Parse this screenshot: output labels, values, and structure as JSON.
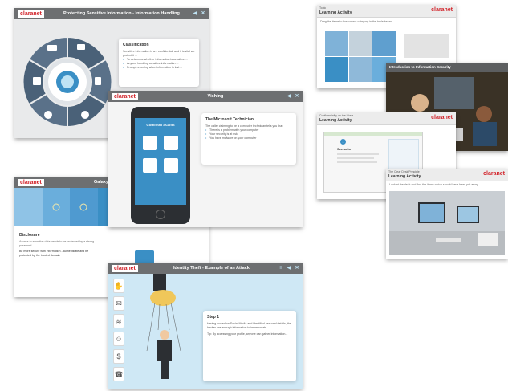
{
  "colors": {
    "brand_red": "#d2232a",
    "header_gray": "#6d6f71",
    "accent_blue": "#3a8fc5",
    "wheel_slate": "#4a6178"
  },
  "brand": "claranet",
  "panel_info_handling": {
    "title": "Protecting Sensitive Information - Information Handling",
    "box_heading": "Classification",
    "box_body": "Sensitive information is a... confidential, and it is vital we protect it ...",
    "bullets": [
      "To determine whether information is sensitive ...",
      "Anyone handling sensitive information ...",
      "Prompt reporting when information is lost ..."
    ],
    "wheel_icons": [
      "envelope-icon",
      "book-icon",
      "search-icon",
      "refresh-icon",
      "server-icon",
      "laptop-icon"
    ]
  },
  "panel_vishing": {
    "title": "Vishing",
    "phone_screen_title": "Common Scams",
    "box_heading": "The Microsoft Technician",
    "box_body": "The caller claiming to be a computer technician tells you that:",
    "bullets": [
      "There is a problem with your computer",
      "Your security is at risk",
      "You have malware on your computer"
    ]
  },
  "panel_safety_aware": {
    "title": "Galaxy Security Aware",
    "heading": "Disclosure",
    "body_1": "Access to sensitive data needs to be protected by a strong password...",
    "body_2": "Be more secure with information - authenticate and be protected by the trusted domain"
  },
  "panel_identity_theft": {
    "title": "Identity Theft - Example of an Attack",
    "step_heading": "Step 1",
    "step_body": "Having looked on Social Media and identified personal details, the hacker has enough information to impersonate...",
    "step_body_2": "Tip: By accessing your profile, anyone can gather information..."
  },
  "panel_learning_1": {
    "small": "Topic",
    "name": "Learning Activity",
    "intro": "Drag the items to the correct category in the table below."
  },
  "panel_info_security": {
    "title": "Introduction to Information Security"
  },
  "panel_learning_2": {
    "small": "Confidentiality on the Move",
    "name": "Learning Activity",
    "section": "Scenario",
    "badge": "1"
  },
  "panel_learning_3": {
    "small": "The Clear Desk Principle",
    "name": "Learning Activity",
    "intro": "Look at the desk and find the items which should have been put away."
  }
}
